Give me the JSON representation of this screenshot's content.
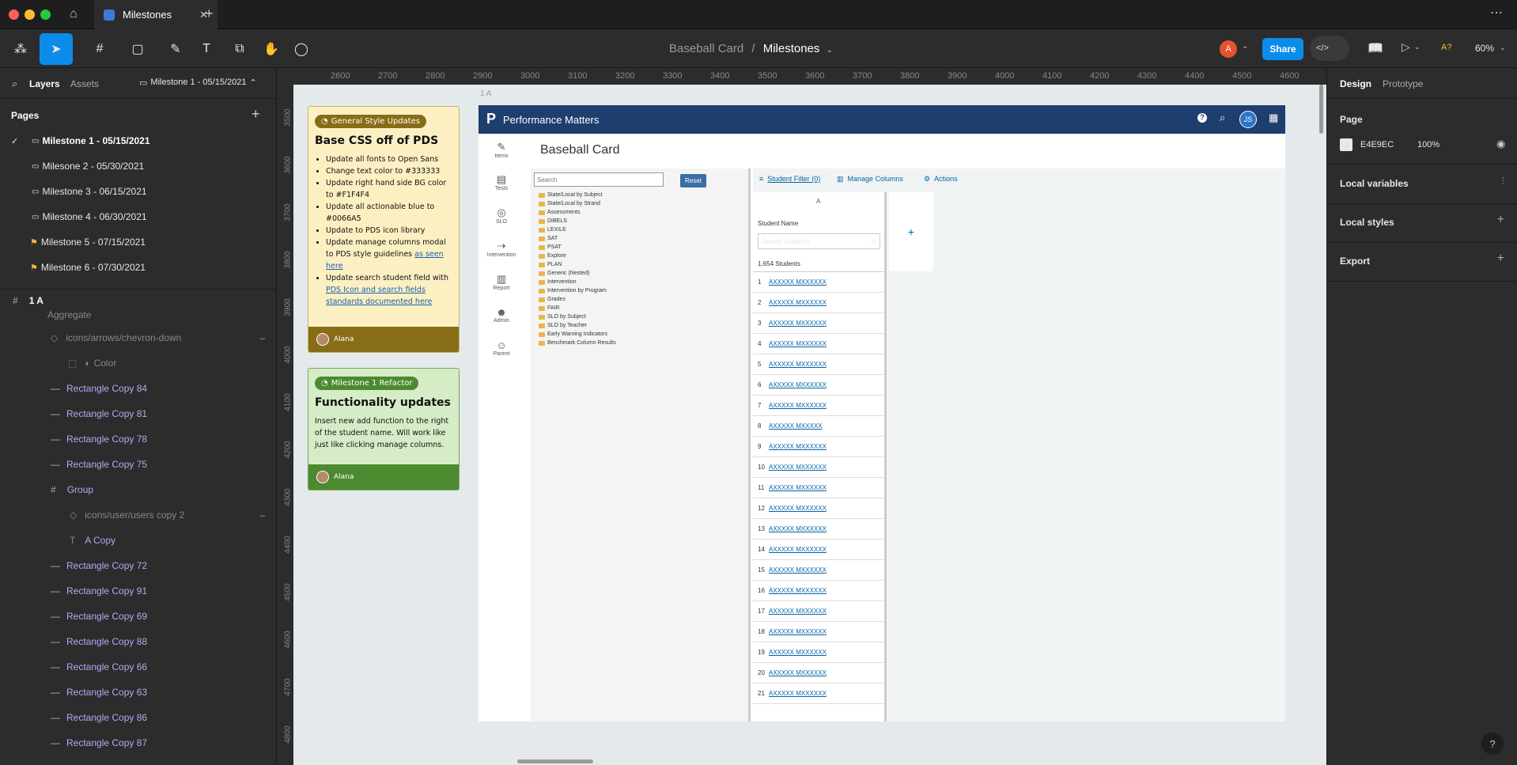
{
  "tabbar": {
    "tab_label": "Milestones"
  },
  "toolbar": {
    "file_name": "Baseball Card",
    "separator": "/",
    "page_name": "Milestones",
    "avatar_letter": "A",
    "share_label": "Share",
    "zoom": "60%",
    "font_warning": "A?"
  },
  "left_panel": {
    "tab_layers": "Layers",
    "tab_assets": "Assets",
    "current_page": "Milestone 1 - 05/15/2021",
    "pages_title": "Pages",
    "pages": [
      "Milestone 1 - 05/15/2021",
      "Milesone 2 - 05/30/2021",
      "Milestone 3 - 06/15/2021",
      "Milestone 4 - 06/30/2021",
      "Milestone 5 - 07/15/2021",
      "Milestone 6 - 07/30/2021"
    ],
    "frame_name": "1 A",
    "partial_layer": "Aggregate",
    "layers": [
      "icons/arrows/chevron-down",
      "Color",
      "Rectangle Copy 84",
      "Rectangle Copy 81",
      "Rectangle Copy 78",
      "Rectangle Copy 75",
      "Group",
      "icons/user/users copy 2",
      "A Copy",
      "Rectangle Copy 72",
      "Rectangle Copy 91",
      "Rectangle Copy 69",
      "Rectangle Copy 88",
      "Rectangle Copy 66",
      "Rectangle Copy 63",
      "Rectangle Copy 86",
      "Rectangle Copy 87"
    ]
  },
  "ruler": {
    "x": [
      "2600",
      "2700",
      "2800",
      "2900",
      "3000",
      "3100",
      "3200",
      "3300",
      "3400",
      "3500",
      "3600",
      "3700",
      "3800",
      "3900",
      "4000",
      "4100",
      "4200",
      "4300",
      "4400",
      "4500",
      "4600"
    ],
    "y": [
      "3500",
      "3600",
      "3700",
      "3800",
      "3900",
      "4000",
      "4100",
      "4200",
      "4300",
      "4400",
      "4500",
      "4600",
      "4700",
      "4800"
    ]
  },
  "right_panel": {
    "tab_design": "Design",
    "tab_prototype": "Prototype",
    "page_section": "Page",
    "bg_hex": "E4E9EC",
    "bg_opacity": "100%",
    "local_variables": "Local variables",
    "local_styles": "Local styles",
    "export": "Export",
    "help": "?"
  },
  "canvas": {
    "frame_label": "1 A",
    "sticky1": {
      "badge": "General Style Updates",
      "title": "Base CSS off of PDS",
      "bullets": [
        "Update all fonts to Open Sans",
        "Change text color to #333333",
        "Update right hand side BG color to #F1F4F4",
        "Update all actionable blue to #0066A5",
        "Update to PDS icon library",
        "Update manage columns modal to PDS style guidelines"
      ],
      "link1": "as seen here",
      "bullet7": "Update search student field with",
      "link2": "PDS Icon and search fields standards documented here",
      "author": "Alana"
    },
    "sticky2": {
      "badge": "Milestone 1 Refactor",
      "title": "Functionality updates",
      "body": "Insert new add function to the right of the student name. Will work like just like clicking manage columns.",
      "author": "Alana"
    },
    "app": {
      "brand": "Performance Matters",
      "user_initials": "JS",
      "page_title": "Baseball Card",
      "nav": [
        "Items",
        "Tests",
        "SLO",
        "Intervention",
        "Report",
        "Admin",
        "Parent"
      ],
      "search_placeholder": "Search",
      "reset": "Reset",
      "tree": [
        "State/Local by Subject",
        "State/Local by Strand",
        "Assessments",
        "DIBELS",
        "LEXILE",
        "SAT",
        "PSAT",
        "Explore",
        "PLAN",
        "Generic (Nested)",
        "Intervention",
        "Intervention by Program",
        "Grades",
        "FAIR",
        "SLO by Subject",
        "SLO by Teacher",
        "Early Warning Indicators",
        "Benchmark Column Results"
      ],
      "student_filter": "Student Filter (0)",
      "manage_columns": "Manage Columns",
      "actions": "Actions",
      "column_letter": "A",
      "student_name_label": "Student Name",
      "search_students": "Search Students",
      "student_count": "1,654 Students",
      "rows": [
        [
          "1",
          "AXXXXX MXXXXXX"
        ],
        [
          "2",
          "AXXXXX MXXXXXX"
        ],
        [
          "3",
          "AXXXXX MXXXXXX"
        ],
        [
          "4",
          "AXXXXX MXXXXXX"
        ],
        [
          "5",
          "AXXXXX MXXXXXX"
        ],
        [
          "6",
          "AXXXXX MXXXXXX"
        ],
        [
          "7",
          "AXXXXX MXXXXXX"
        ],
        [
          "8",
          "AXXXXX MXXXXX"
        ],
        [
          "9",
          "AXXXXX MXXXXXX"
        ],
        [
          "10",
          "AXXXXX MXXXXXX"
        ],
        [
          "11",
          "AXXXXX MXXXXXX"
        ],
        [
          "12",
          "AXXXXX MXXXXXX"
        ],
        [
          "13",
          "AXXXXX MXXXXXX"
        ],
        [
          "14",
          "AXXXXX MXXXXXX"
        ],
        [
          "15",
          "AXXXXX MXXXXXX"
        ],
        [
          "16",
          "AXXXXX MXXXXXX"
        ],
        [
          "17",
          "AXXXXX MXXXXXX"
        ],
        [
          "18",
          "AXXXXX MXXXXXX"
        ],
        [
          "19",
          "AXXXXX MXXXXXX"
        ],
        [
          "20",
          "AXXXXX MXXXXXX"
        ],
        [
          "21",
          "AXXXXX MXXXXXX"
        ]
      ],
      "add_column": "+"
    }
  }
}
